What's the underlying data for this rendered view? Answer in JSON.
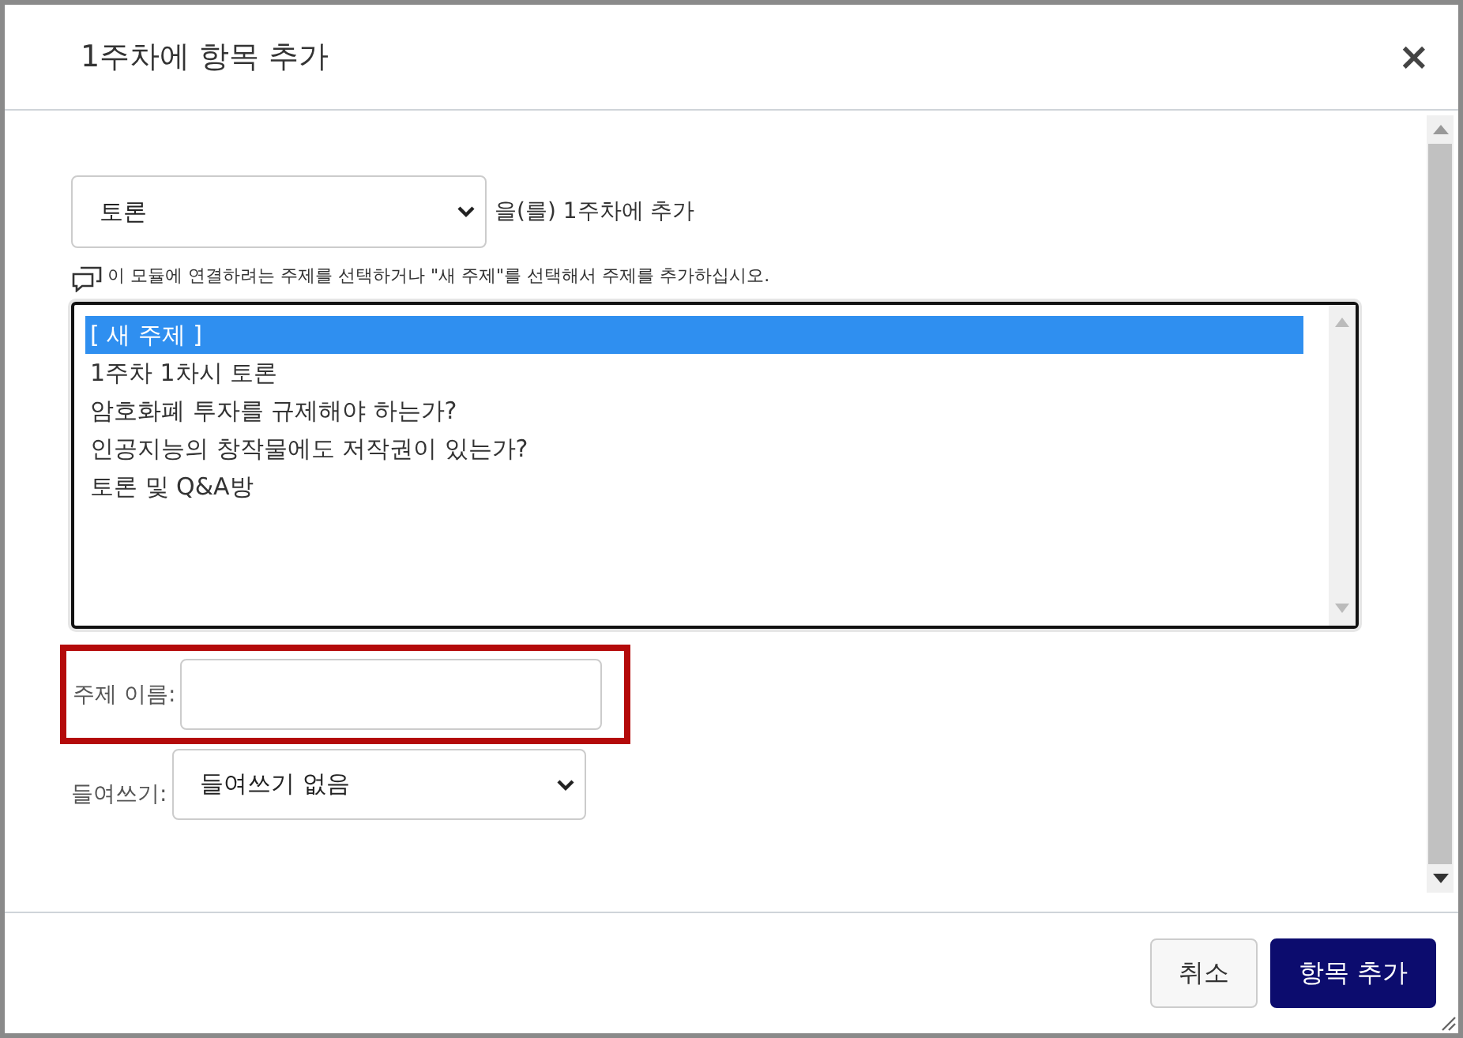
{
  "dialog": {
    "title": "1주차에 항목 추가",
    "close": "×"
  },
  "type_select": {
    "value": "토론",
    "suffix": "을(를) 1주차에 추가"
  },
  "hint": "이 모듈에 연결하려는 주제를 선택하거나 \"새 주제\"를 선택해서 주제를 추가하십시오.",
  "topics": [
    {
      "label": "[ 새 주제 ]",
      "selected": true
    },
    {
      "label": "1주차 1차시 토론",
      "selected": false
    },
    {
      "label": "암호화폐 투자를 규제해야 하는가?",
      "selected": false
    },
    {
      "label": "인공지능의 창작물에도 저작권이 있는가?",
      "selected": false
    },
    {
      "label": "토론 및 Q&A방",
      "selected": false
    }
  ],
  "topic_name": {
    "label": "주제 이름:",
    "highlighted": true
  },
  "indent": {
    "label": "들여쓰기:",
    "value": "들여쓰기 없음"
  },
  "buttons": [
    {
      "label": "취소",
      "kind": "secondary"
    },
    {
      "label": "항목 추가",
      "kind": "primary"
    }
  ]
}
